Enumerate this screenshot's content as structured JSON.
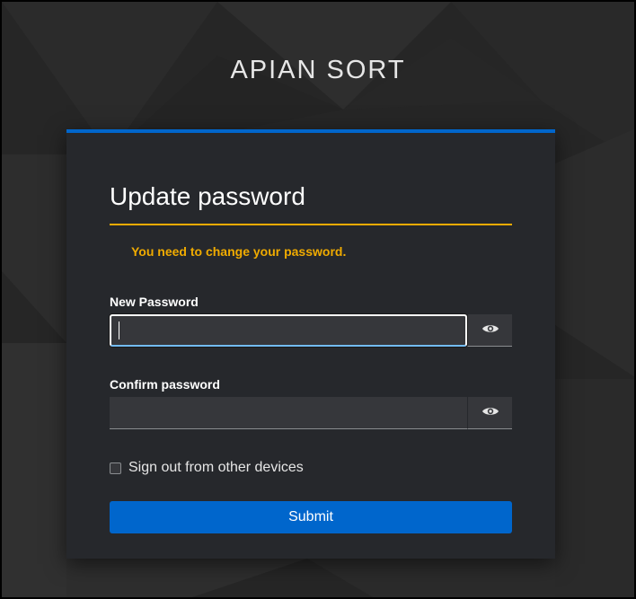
{
  "brand": {
    "name": "APIAN SORT"
  },
  "card": {
    "title": "Update password",
    "alert": "You need to change your password.",
    "new_password": {
      "label": "New Password",
      "value": "",
      "toggle_icon": "eye-icon"
    },
    "confirm_password": {
      "label": "Confirm password",
      "value": "",
      "toggle_icon": "eye-icon"
    },
    "sign_out": {
      "label": "Sign out from other devices",
      "checked": false
    },
    "submit_label": "Submit"
  },
  "colors": {
    "accent": "#0066cc",
    "warning": "#f0ab00",
    "card_bg": "#26282c",
    "page_bg": "#262626"
  }
}
